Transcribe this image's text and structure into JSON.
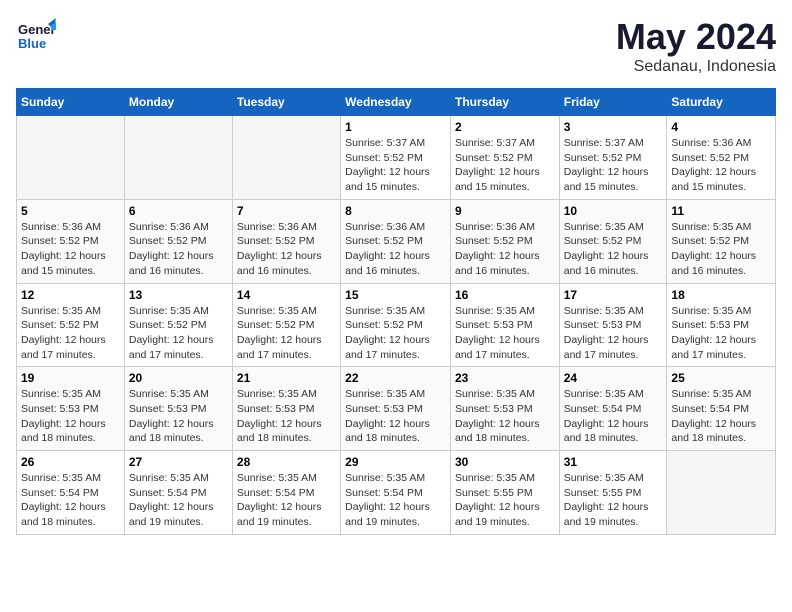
{
  "header": {
    "logo": "GeneralBlue",
    "month": "May 2024",
    "location": "Sedanau, Indonesia"
  },
  "weekdays": [
    "Sunday",
    "Monday",
    "Tuesday",
    "Wednesday",
    "Thursday",
    "Friday",
    "Saturday"
  ],
  "weeks": [
    [
      {
        "day": "",
        "empty": true
      },
      {
        "day": "",
        "empty": true
      },
      {
        "day": "",
        "empty": true
      },
      {
        "day": "1",
        "sunrise": "Sunrise: 5:37 AM",
        "sunset": "Sunset: 5:52 PM",
        "daylight": "Daylight: 12 hours and 15 minutes."
      },
      {
        "day": "2",
        "sunrise": "Sunrise: 5:37 AM",
        "sunset": "Sunset: 5:52 PM",
        "daylight": "Daylight: 12 hours and 15 minutes."
      },
      {
        "day": "3",
        "sunrise": "Sunrise: 5:37 AM",
        "sunset": "Sunset: 5:52 PM",
        "daylight": "Daylight: 12 hours and 15 minutes."
      },
      {
        "day": "4",
        "sunrise": "Sunrise: 5:36 AM",
        "sunset": "Sunset: 5:52 PM",
        "daylight": "Daylight: 12 hours and 15 minutes."
      }
    ],
    [
      {
        "day": "5",
        "sunrise": "Sunrise: 5:36 AM",
        "sunset": "Sunset: 5:52 PM",
        "daylight": "Daylight: 12 hours and 15 minutes."
      },
      {
        "day": "6",
        "sunrise": "Sunrise: 5:36 AM",
        "sunset": "Sunset: 5:52 PM",
        "daylight": "Daylight: 12 hours and 16 minutes."
      },
      {
        "day": "7",
        "sunrise": "Sunrise: 5:36 AM",
        "sunset": "Sunset: 5:52 PM",
        "daylight": "Daylight: 12 hours and 16 minutes."
      },
      {
        "day": "8",
        "sunrise": "Sunrise: 5:36 AM",
        "sunset": "Sunset: 5:52 PM",
        "daylight": "Daylight: 12 hours and 16 minutes."
      },
      {
        "day": "9",
        "sunrise": "Sunrise: 5:36 AM",
        "sunset": "Sunset: 5:52 PM",
        "daylight": "Daylight: 12 hours and 16 minutes."
      },
      {
        "day": "10",
        "sunrise": "Sunrise: 5:35 AM",
        "sunset": "Sunset: 5:52 PM",
        "daylight": "Daylight: 12 hours and 16 minutes."
      },
      {
        "day": "11",
        "sunrise": "Sunrise: 5:35 AM",
        "sunset": "Sunset: 5:52 PM",
        "daylight": "Daylight: 12 hours and 16 minutes."
      }
    ],
    [
      {
        "day": "12",
        "sunrise": "Sunrise: 5:35 AM",
        "sunset": "Sunset: 5:52 PM",
        "daylight": "Daylight: 12 hours and 17 minutes."
      },
      {
        "day": "13",
        "sunrise": "Sunrise: 5:35 AM",
        "sunset": "Sunset: 5:52 PM",
        "daylight": "Daylight: 12 hours and 17 minutes."
      },
      {
        "day": "14",
        "sunrise": "Sunrise: 5:35 AM",
        "sunset": "Sunset: 5:52 PM",
        "daylight": "Daylight: 12 hours and 17 minutes."
      },
      {
        "day": "15",
        "sunrise": "Sunrise: 5:35 AM",
        "sunset": "Sunset: 5:52 PM",
        "daylight": "Daylight: 12 hours and 17 minutes."
      },
      {
        "day": "16",
        "sunrise": "Sunrise: 5:35 AM",
        "sunset": "Sunset: 5:53 PM",
        "daylight": "Daylight: 12 hours and 17 minutes."
      },
      {
        "day": "17",
        "sunrise": "Sunrise: 5:35 AM",
        "sunset": "Sunset: 5:53 PM",
        "daylight": "Daylight: 12 hours and 17 minutes."
      },
      {
        "day": "18",
        "sunrise": "Sunrise: 5:35 AM",
        "sunset": "Sunset: 5:53 PM",
        "daylight": "Daylight: 12 hours and 17 minutes."
      }
    ],
    [
      {
        "day": "19",
        "sunrise": "Sunrise: 5:35 AM",
        "sunset": "Sunset: 5:53 PM",
        "daylight": "Daylight: 12 hours and 18 minutes."
      },
      {
        "day": "20",
        "sunrise": "Sunrise: 5:35 AM",
        "sunset": "Sunset: 5:53 PM",
        "daylight": "Daylight: 12 hours and 18 minutes."
      },
      {
        "day": "21",
        "sunrise": "Sunrise: 5:35 AM",
        "sunset": "Sunset: 5:53 PM",
        "daylight": "Daylight: 12 hours and 18 minutes."
      },
      {
        "day": "22",
        "sunrise": "Sunrise: 5:35 AM",
        "sunset": "Sunset: 5:53 PM",
        "daylight": "Daylight: 12 hours and 18 minutes."
      },
      {
        "day": "23",
        "sunrise": "Sunrise: 5:35 AM",
        "sunset": "Sunset: 5:53 PM",
        "daylight": "Daylight: 12 hours and 18 minutes."
      },
      {
        "day": "24",
        "sunrise": "Sunrise: 5:35 AM",
        "sunset": "Sunset: 5:54 PM",
        "daylight": "Daylight: 12 hours and 18 minutes."
      },
      {
        "day": "25",
        "sunrise": "Sunrise: 5:35 AM",
        "sunset": "Sunset: 5:54 PM",
        "daylight": "Daylight: 12 hours and 18 minutes."
      }
    ],
    [
      {
        "day": "26",
        "sunrise": "Sunrise: 5:35 AM",
        "sunset": "Sunset: 5:54 PM",
        "daylight": "Daylight: 12 hours and 18 minutes."
      },
      {
        "day": "27",
        "sunrise": "Sunrise: 5:35 AM",
        "sunset": "Sunset: 5:54 PM",
        "daylight": "Daylight: 12 hours and 19 minutes."
      },
      {
        "day": "28",
        "sunrise": "Sunrise: 5:35 AM",
        "sunset": "Sunset: 5:54 PM",
        "daylight": "Daylight: 12 hours and 19 minutes."
      },
      {
        "day": "29",
        "sunrise": "Sunrise: 5:35 AM",
        "sunset": "Sunset: 5:54 PM",
        "daylight": "Daylight: 12 hours and 19 minutes."
      },
      {
        "day": "30",
        "sunrise": "Sunrise: 5:35 AM",
        "sunset": "Sunset: 5:55 PM",
        "daylight": "Daylight: 12 hours and 19 minutes."
      },
      {
        "day": "31",
        "sunrise": "Sunrise: 5:35 AM",
        "sunset": "Sunset: 5:55 PM",
        "daylight": "Daylight: 12 hours and 19 minutes."
      },
      {
        "day": "",
        "empty": true
      }
    ]
  ]
}
